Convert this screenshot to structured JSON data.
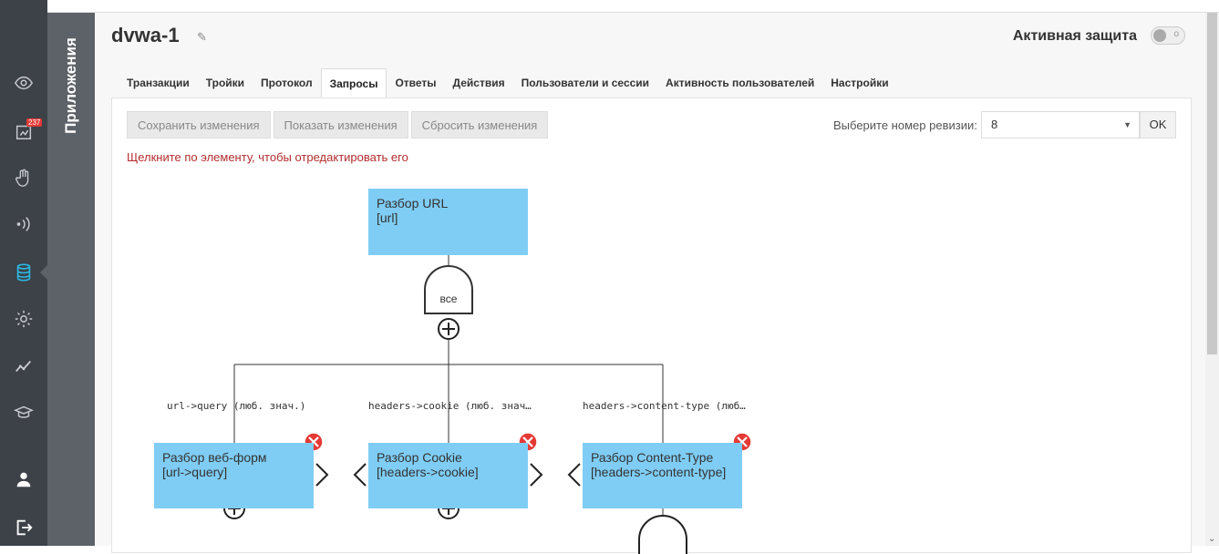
{
  "rail": {
    "badge": "237",
    "icons": [
      "eye-icon",
      "dashboard-icon",
      "hand-icon",
      "signal-icon",
      "database-icon",
      "gear-icon",
      "chart-line-icon",
      "graduation-icon",
      "user-icon",
      "logout-icon"
    ]
  },
  "sidepanel": {
    "title": "Приложения"
  },
  "header": {
    "title": "dvwa-1",
    "active_protection": "Активная защита"
  },
  "tabs": [
    {
      "label": "Транзакции"
    },
    {
      "label": "Тройки"
    },
    {
      "label": "Протокол"
    },
    {
      "label": "Запросы",
      "active": true
    },
    {
      "label": "Ответы"
    },
    {
      "label": "Действия"
    },
    {
      "label": "Пользователи и сессии"
    },
    {
      "label": "Активность пользователей"
    },
    {
      "label": "Настройки"
    }
  ],
  "toolbar": {
    "save": "Сохранить изменения",
    "show": "Показать изменения",
    "reset": "Сбросить изменения",
    "revision_label": "Выберите номер ревизии:",
    "revision_value": "8",
    "ok": "OK"
  },
  "hint": "Щелкните по элементу, чтобы отредактировать его",
  "diagram": {
    "root": {
      "title": "Разбор URL",
      "sub": "[url]"
    },
    "gate": "все",
    "edges": [
      "url->query (люб. знач.)",
      "headers->cookie (люб. знач…",
      "headers->content-type (люб…"
    ],
    "children": [
      {
        "title": "Разбор веб-форм",
        "sub": "[url->query]"
      },
      {
        "title": "Разбор Cookie",
        "sub": "[headers->cookie]"
      },
      {
        "title": "Разбор Content-Type",
        "sub": "[headers->content-type]"
      }
    ]
  },
  "colors": {
    "node": "#7fcdf5",
    "delete": "#e53935",
    "hint": "#b32d2e",
    "rail": "#3d4148"
  }
}
